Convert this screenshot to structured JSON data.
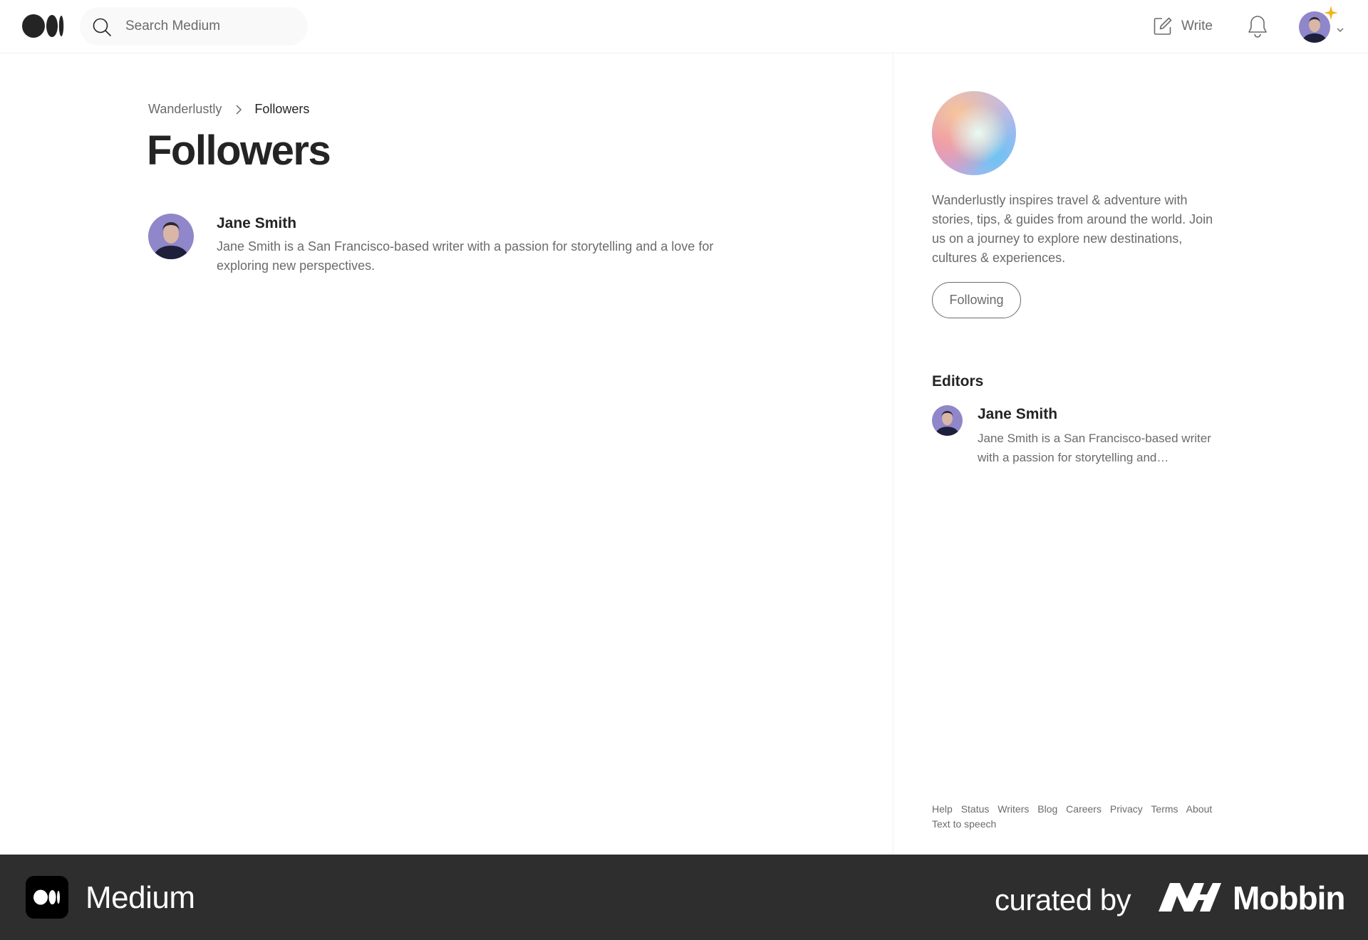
{
  "header": {
    "search": {
      "placeholder": "Search Medium"
    },
    "write_label": "Write",
    "icons": {
      "logo": "medium-logo",
      "search": "search-icon",
      "write": "write-icon",
      "notifications": "bell-icon",
      "profile": "avatar",
      "chevron": "chevron-down-icon"
    }
  },
  "breadcrumb": {
    "publication": "Wanderlustly",
    "current": "Followers"
  },
  "page": {
    "title": "Followers"
  },
  "followers": [
    {
      "name": "Jane Smith",
      "bio": "Jane Smith is a San Francisco-based writer with a passion for storytelling and a love for exploring new perspectives."
    }
  ],
  "sidebar": {
    "publication_description": "Wanderlustly inspires travel & adventure with stories, tips, & guides from around the world. Join us on a journey to explore new destinations, cultures & experiences.",
    "following_label": "Following",
    "editors_title": "Editors",
    "editors": [
      {
        "name": "Jane Smith",
        "bio": "Jane Smith is a San Francisco-based writer with a passion for storytelling and…"
      }
    ],
    "footer_links": [
      "Help",
      "Status",
      "Writers",
      "Blog",
      "Careers",
      "Privacy",
      "Terms",
      "About",
      "Text to speech"
    ]
  },
  "banner": {
    "app_name": "Medium",
    "curated_by": "curated by",
    "brand": "Mobbin"
  },
  "colors": {
    "text_primary": "#242424",
    "text_secondary": "#6b6b6b",
    "banner_bg": "#2e2e2e",
    "notification_star": "#f2b21b"
  }
}
